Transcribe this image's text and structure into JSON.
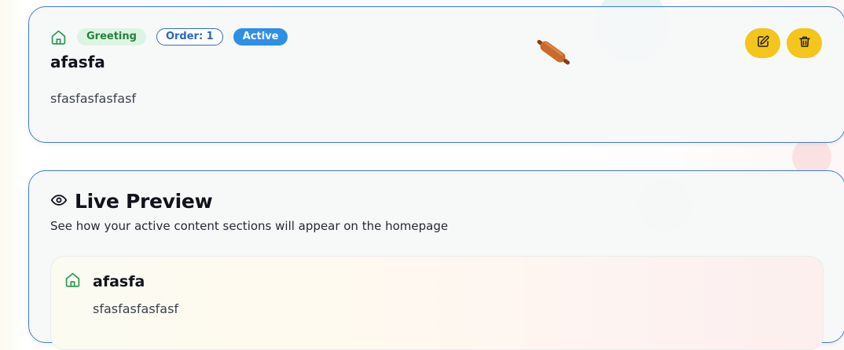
{
  "content_item": {
    "type_badge": "Greeting",
    "order_badge": "Order: 1",
    "status_badge": "Active",
    "title": "afasfa",
    "description": "sfasfasfasfasf",
    "icons": {
      "type": "home-icon",
      "edit": "edit-icon",
      "delete": "trash-icon"
    }
  },
  "live_preview": {
    "title": "Live Preview",
    "subtitle": "See how your active content sections will appear on the homepage",
    "icon": "eye-icon",
    "item": {
      "title": "afasfa",
      "description": "sfasfasfasfasf",
      "icon": "home-icon"
    }
  },
  "colors": {
    "accent_blue": "#2e8fe6",
    "action_yellow": "#f4c51a",
    "success_green": "#2a7f3f",
    "card_border": "#3f7bd6"
  }
}
